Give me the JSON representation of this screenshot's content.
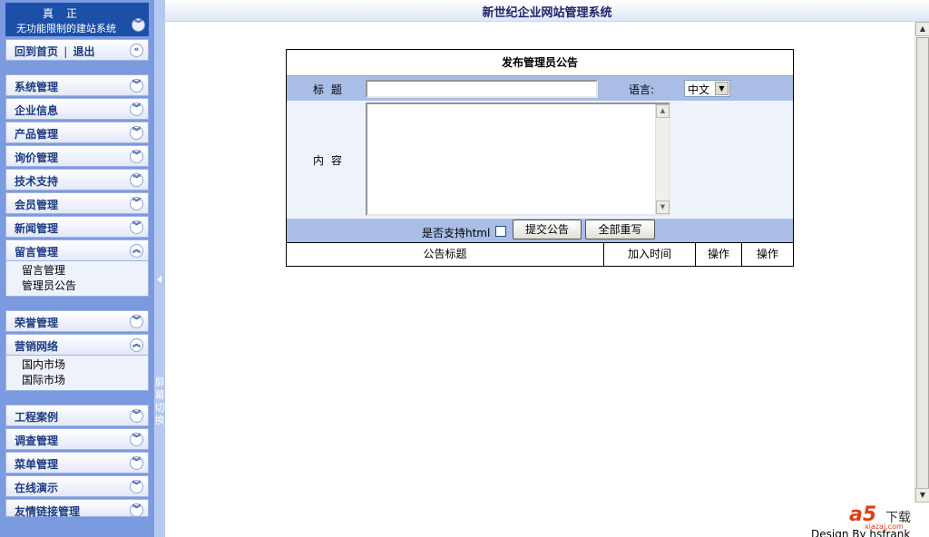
{
  "app": {
    "title": "新世纪企业网站管理系统",
    "brand_line1": "真正",
    "brand_line2": "无功能限制的建站系统"
  },
  "nav_home": {
    "home": "回到首页",
    "separator": "|",
    "logout": "退出"
  },
  "sidebar": {
    "sections": [
      {
        "label": "系统管理",
        "expanded": false
      },
      {
        "label": "企业信息",
        "expanded": false
      },
      {
        "label": "产品管理",
        "expanded": false
      },
      {
        "label": "询价管理",
        "expanded": false
      },
      {
        "label": "技术支持",
        "expanded": false
      },
      {
        "label": "会员管理",
        "expanded": false
      },
      {
        "label": "新闻管理",
        "expanded": false
      },
      {
        "label": "留言管理",
        "expanded": true,
        "items": [
          "留言管理",
          "管理员公告"
        ]
      },
      {
        "label": "荣誉管理",
        "expanded": false
      },
      {
        "label": "营销网络",
        "expanded": true,
        "items": [
          "国内市场",
          "国际市场"
        ]
      },
      {
        "label": "工程案例",
        "expanded": false
      },
      {
        "label": "调查管理",
        "expanded": false
      },
      {
        "label": "菜单管理",
        "expanded": false
      },
      {
        "label": "在线演示",
        "expanded": false
      },
      {
        "label": "友情链接管理",
        "expanded": false
      }
    ]
  },
  "splitter": {
    "label": "屏幕切换"
  },
  "form": {
    "heading": "发布管理员公告",
    "title_label": "标 题",
    "title_value": "",
    "language_label": "语言:",
    "language_value": "中文",
    "content_label": "内 容",
    "content_value": "",
    "html_support_label": "是否支持html",
    "html_support_checked": false,
    "submit_label": "提交公告",
    "reset_label": "全部重写"
  },
  "table": {
    "columns": [
      "公告标题",
      "加入时间",
      "操作",
      "操作"
    ]
  },
  "footer": {
    "credit": "Design By hsfrank",
    "logo_main": "a5",
    "logo_cn": "下载",
    "logo_domain": "xiazai.com"
  },
  "icons": {
    "collapse": "double-chevron-down-icon",
    "expand": "double-chevron-up-icon",
    "back": "double-chevron-left-icon"
  },
  "colors": {
    "sidebar_bg": "#7b9ae0",
    "brand_bg": "#1c4fa8",
    "row_blue": "#a9bde6",
    "row_light": "#eef3fb",
    "title_text": "#23236b"
  }
}
